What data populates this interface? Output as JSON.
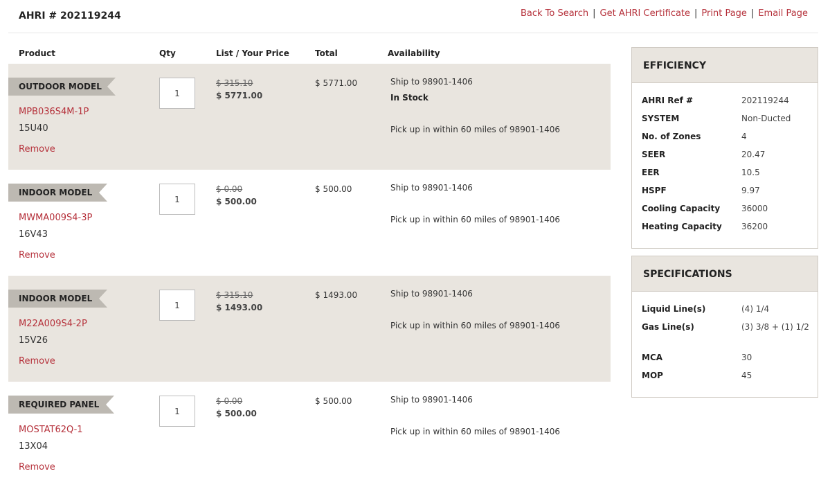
{
  "header": {
    "ahri_title": "AHRI # 202119244",
    "links": [
      "Back To Search",
      "Get AHRI Certificate",
      "Print Page",
      "Email Page"
    ],
    "separator": "|"
  },
  "columns": {
    "product": "Product",
    "qty": "Qty",
    "price": "List / Your Price",
    "total": "Total",
    "availability": "Availability"
  },
  "items": [
    {
      "type": "OUTDOOR MODEL",
      "model": "MPB036S4M-1P",
      "sub": "15U40",
      "remove": "Remove",
      "qty": "1",
      "list_price": "$ 315.10",
      "your_price": "$ 5771.00",
      "total": "$ 5771.00",
      "ship": "Ship to 98901-1406",
      "stock": "In Stock",
      "pickup": "Pick up in within 60 miles of 98901-1406"
    },
    {
      "type": "INDOOR MODEL",
      "model": "MWMA009S4-3P",
      "sub": "16V43",
      "remove": "Remove",
      "qty": "1",
      "list_price": "$ 0.00",
      "your_price": "$ 500.00",
      "total": "$ 500.00",
      "ship": "Ship to 98901-1406",
      "pickup": "Pick up in within 60 miles of 98901-1406"
    },
    {
      "type": "INDOOR MODEL",
      "model": "M22A009S4-2P",
      "sub": "15V26",
      "remove": "Remove",
      "qty": "1",
      "list_price": "$ 315.10",
      "your_price": "$ 1493.00",
      "total": "$ 1493.00",
      "ship": "Ship to 98901-1406",
      "pickup": "Pick up in within 60 miles of 98901-1406"
    },
    {
      "type": "REQUIRED PANEL",
      "model": "MOSTAT62Q-1",
      "sub": "13X04",
      "remove": "Remove",
      "qty": "1",
      "list_price": "$ 0.00",
      "your_price": "$ 500.00",
      "total": "$ 500.00",
      "ship": "Ship to 98901-1406",
      "pickup": "Pick up in within 60 miles of 98901-1406"
    }
  ],
  "efficiency": {
    "title": "EFFICIENCY",
    "rows": [
      {
        "label": "AHRI Ref #",
        "value": "202119244"
      },
      {
        "label": "SYSTEM",
        "value": "Non-Ducted"
      },
      {
        "label": "No. of Zones",
        "value": "4"
      },
      {
        "label": "SEER",
        "value": "20.47"
      },
      {
        "label": "EER",
        "value": "10.5"
      },
      {
        "label": "HSPF",
        "value": "9.97"
      },
      {
        "label": "Cooling Capacity",
        "value": "36000"
      },
      {
        "label": "Heating Capacity",
        "value": "36200"
      }
    ]
  },
  "specifications": {
    "title": "SPECIFICATIONS",
    "rows": [
      {
        "label": "Liquid Line(s)",
        "value": "(4) 1/4"
      },
      {
        "label": "Gas Line(s)",
        "value": "(3) 3/8 + (1) 1/2"
      },
      {
        "label": "MCA",
        "value": "30"
      },
      {
        "label": "MOP",
        "value": "45"
      }
    ]
  }
}
